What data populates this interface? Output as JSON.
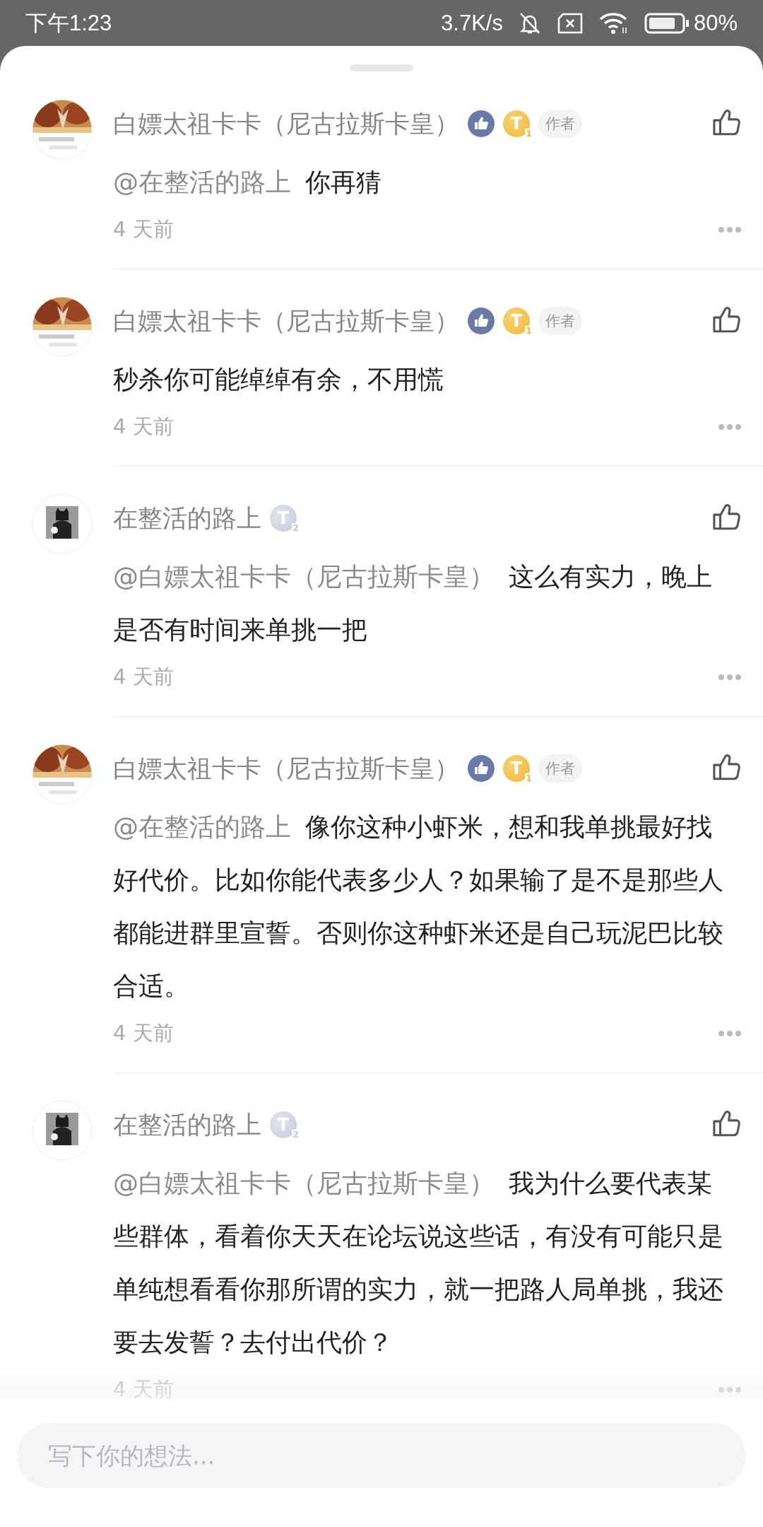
{
  "status_bar": {
    "time": "下午1:23",
    "net_speed": "3.7K/s",
    "battery": "80%"
  },
  "comments": [
    {
      "author": "白嫖太祖卡卡（尼古拉斯卡皇）",
      "is_author": true,
      "medal": true,
      "level_badge": {
        "kind": "gold",
        "letter": "T",
        "number": "1"
      },
      "author_tag": "作者",
      "mention": "@在整活的路上",
      "text": "你再猜",
      "time": "4 天前"
    },
    {
      "author": "白嫖太祖卡卡（尼古拉斯卡皇）",
      "is_author": true,
      "medal": true,
      "level_badge": {
        "kind": "gold",
        "letter": "T",
        "number": "1"
      },
      "author_tag": "作者",
      "text": "秒杀你可能绰绰有余，不用慌",
      "time": "4 天前"
    },
    {
      "author": "在整活的路上",
      "is_author": false,
      "medal": false,
      "level_badge": {
        "kind": "silver",
        "letter": "T",
        "number": "2"
      },
      "mention": "@白嫖太祖卡卡（尼古拉斯卡皇）",
      "text": "这么有实力，晚上是否有时间来单挑一把",
      "time": "4 天前"
    },
    {
      "author": "白嫖太祖卡卡（尼古拉斯卡皇）",
      "is_author": true,
      "medal": true,
      "level_badge": {
        "kind": "gold",
        "letter": "T",
        "number": "1"
      },
      "author_tag": "作者",
      "mention": "@在整活的路上",
      "text": "像你这种小虾米，想和我单挑最好找好代价。比如你能代表多少人？如果输了是不是那些人都能进群里宣誓。否则你这种虾米还是自己玩泥巴比较合适。",
      "time": "4 天前"
    },
    {
      "author": "在整活的路上",
      "is_author": false,
      "medal": false,
      "level_badge": {
        "kind": "silver",
        "letter": "T",
        "number": "2"
      },
      "mention": "@白嫖太祖卡卡（尼古拉斯卡皇）",
      "text": "我为什么要代表某些群体，看着你天天在论坛说这些话，有没有可能只是单纯想看看你那所谓的实力，就一把路人局单挑，我还要去发誓？去付出代价？",
      "time": "4 天前"
    }
  ],
  "input": {
    "placeholder": "写下你的想法..."
  }
}
